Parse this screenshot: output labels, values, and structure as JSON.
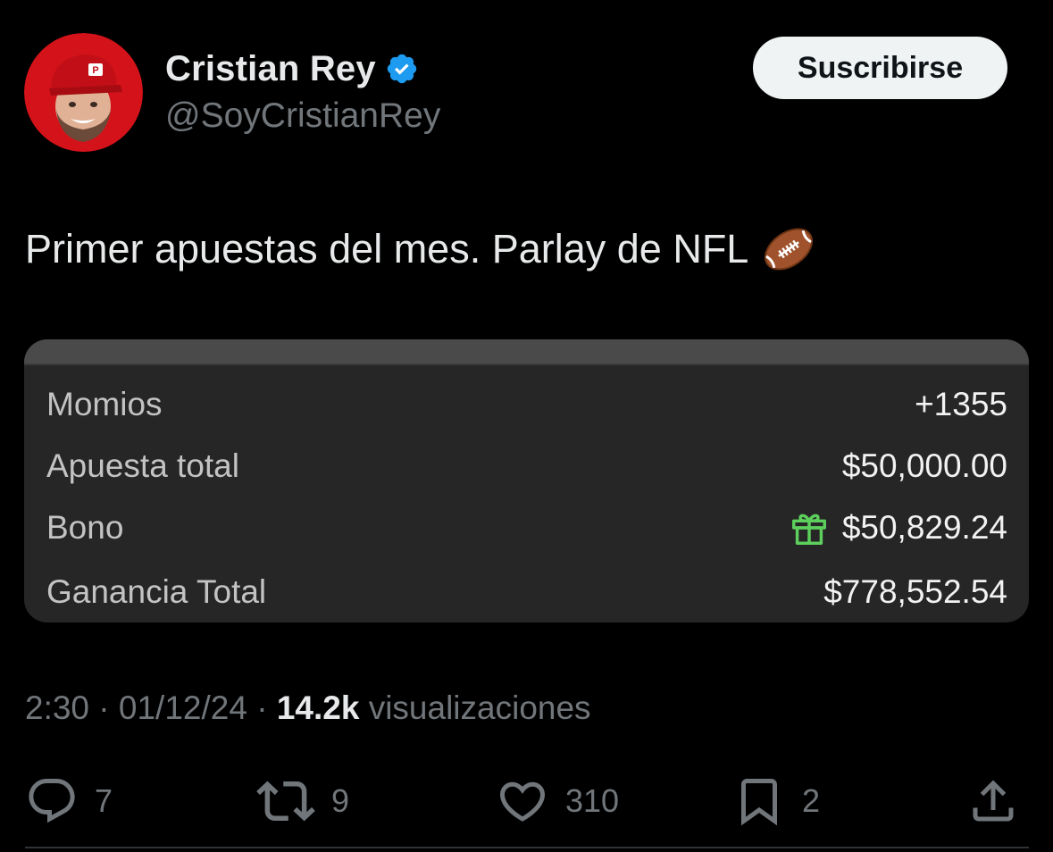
{
  "header": {
    "display_name": "Cristian Rey",
    "handle": "@SoyCristianRey",
    "subscribe_label": "Suscribirse",
    "verified_icon": "verified-badge-icon",
    "avatar_image": "cartoon-avatar-red-cap"
  },
  "tweet": {
    "text": "Primer apuestas del mes. Parlay de NFL",
    "emoji_icon": "american-football-icon"
  },
  "bet_card": {
    "rows": [
      {
        "label": "Momios",
        "value": "+1355"
      },
      {
        "label": "Apuesta total",
        "value": "$50,000.00"
      },
      {
        "label": "Bono",
        "value": "$50,829.24",
        "icon": "gift-icon"
      },
      {
        "label": "Ganancia Total",
        "value": "$778,552.54"
      }
    ]
  },
  "meta": {
    "time": "2:30",
    "separator": "·",
    "date": "01/12/24",
    "views_count": "14.2k",
    "views_label": "visualizaciones"
  },
  "actions": {
    "replies": {
      "icon": "reply-icon",
      "count": "7"
    },
    "reposts": {
      "icon": "repost-icon",
      "count": "9"
    },
    "likes": {
      "icon": "heart-icon",
      "count": "310"
    },
    "bookmarks": {
      "icon": "bookmark-icon",
      "count": "2"
    },
    "share": {
      "icon": "share-icon"
    }
  },
  "colors": {
    "background": "#000000",
    "primary_text": "#e7e9ea",
    "secondary_text": "#71767b",
    "verified_blue": "#1d9bf0",
    "card_bg": "#262626",
    "gift_green": "#5ccf5c"
  }
}
